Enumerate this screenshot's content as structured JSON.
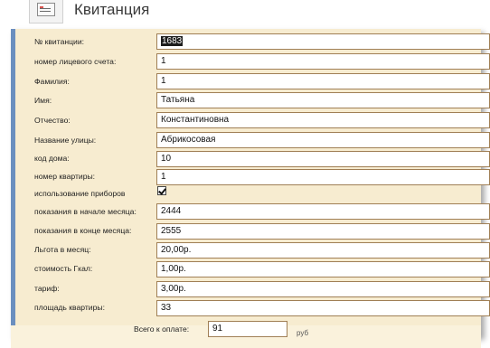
{
  "form": {
    "title": "Квитанция",
    "icon": "form-icon"
  },
  "fields": [
    {
      "label": "№ квитанции:",
      "value": "1683"
    },
    {
      "label": "номер лицевого счета:",
      "value": "1"
    },
    {
      "label": "Фамилия:",
      "value": "1"
    },
    {
      "label": "Имя:",
      "value": "Татьяна"
    },
    {
      "label": "Отчество:",
      "value": "Константиновна"
    },
    {
      "label": "Название улицы:",
      "value": "Абрикосовая"
    },
    {
      "label": "код дома:",
      "value": "10"
    },
    {
      "label": "номер квартиры:",
      "value": "1"
    },
    {
      "label": "использование приборов",
      "checked": true
    },
    {
      "label": "показания в начале месяца:",
      "value": "2444"
    },
    {
      "label": "показания в конце месяца:",
      "value": "2555"
    },
    {
      "label": "Льгота в месяц:",
      "value": "20,00р."
    },
    {
      "label": "стоимость Гкал:",
      "value": "1,00р."
    },
    {
      "label": "тариф:",
      "value": "3,00р."
    },
    {
      "label": "площадь квартиры:",
      "value": "33"
    }
  ],
  "total": {
    "label": "Всего к оплате:",
    "value": "91",
    "unit": "руб"
  },
  "colors": {
    "panel": "#f7ecd0",
    "field_border": "#a07f55",
    "accent_bar": "#6b8fbf"
  }
}
